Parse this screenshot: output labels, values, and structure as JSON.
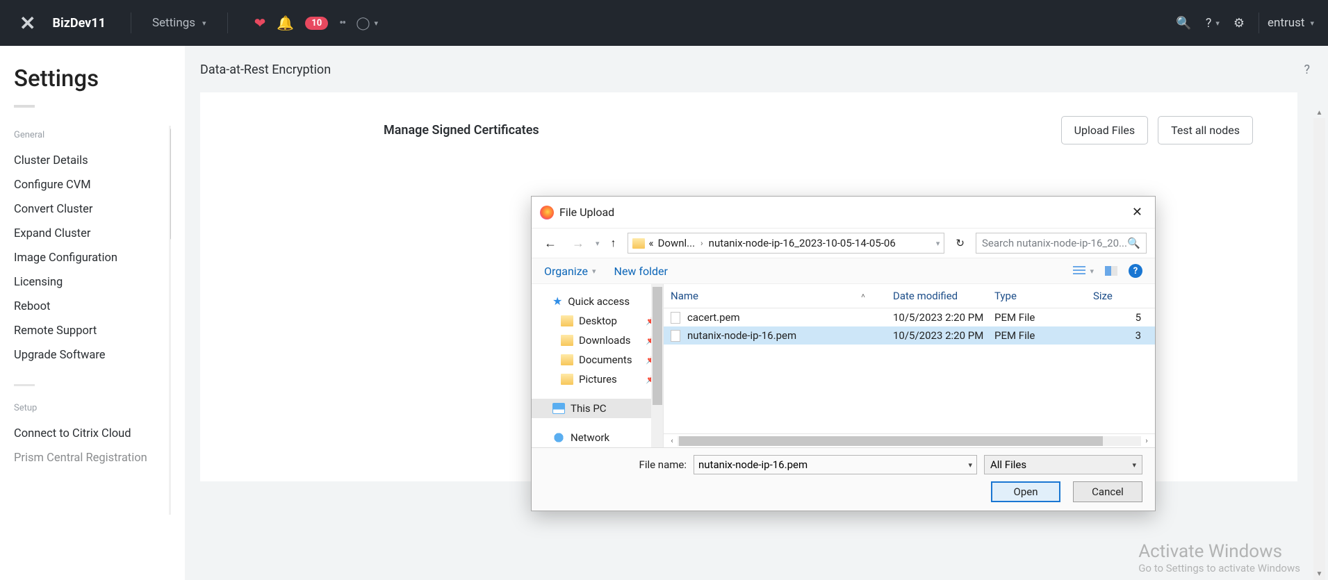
{
  "topbar": {
    "cluster": "BizDev11",
    "nav_label": "Settings",
    "badge": "10",
    "user": "entrust"
  },
  "sidebar": {
    "title": "Settings",
    "section_general": "General",
    "items_general": [
      "Cluster Details",
      "Configure CVM",
      "Convert Cluster",
      "Expand Cluster",
      "Image Configuration",
      "Licensing",
      "Reboot",
      "Remote Support",
      "Upgrade Software"
    ],
    "section_setup": "Setup",
    "items_setup": [
      "Connect to Citrix Cloud",
      "Prism Central Registration"
    ]
  },
  "page": {
    "header": "Data-at-Rest Encryption",
    "card_title": "Manage Signed Certificates",
    "btn_upload": "Upload Files",
    "btn_test": "Test all nodes"
  },
  "dialog": {
    "title": "File Upload",
    "breadcrumb": {
      "prefix": "«",
      "seg1": "Downl...",
      "seg2": "nutanix-node-ip-16_2023-10-05-14-05-06"
    },
    "search_placeholder": "Search nutanix-node-ip-16_20...",
    "organize": "Organize",
    "new_folder": "New folder",
    "tree": {
      "quick_access": "Quick access",
      "desktop": "Desktop",
      "downloads": "Downloads",
      "documents": "Documents",
      "pictures": "Pictures",
      "this_pc": "This PC",
      "network": "Network"
    },
    "columns": {
      "name": "Name",
      "date": "Date modified",
      "type": "Type",
      "size": "Size"
    },
    "files": [
      {
        "name": "cacert.pem",
        "date": "10/5/2023 2:20 PM",
        "type": "PEM File",
        "size": "5",
        "selected": false
      },
      {
        "name": "nutanix-node-ip-16.pem",
        "date": "10/5/2023 2:20 PM",
        "type": "PEM File",
        "size": "3",
        "selected": true
      }
    ],
    "filename_label": "File name:",
    "filename_value": "nutanix-node-ip-16.pem",
    "filter": "All Files",
    "btn_open": "Open",
    "btn_cancel": "Cancel"
  },
  "watermark": {
    "l1": "Activate Windows",
    "l2": "Go to Settings to activate Windows"
  }
}
